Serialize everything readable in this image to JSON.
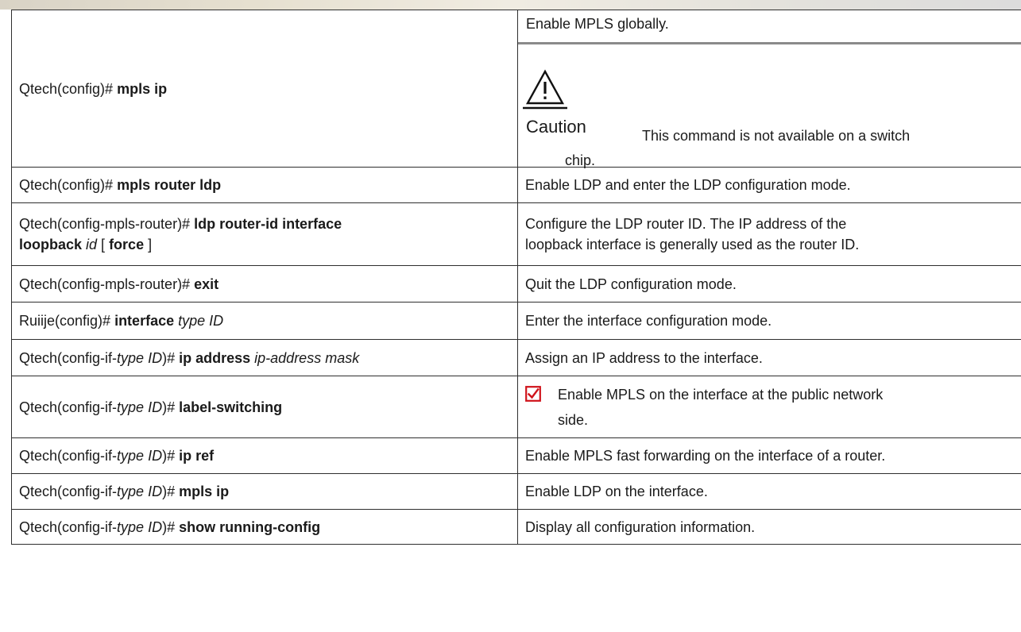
{
  "rows": [
    {
      "cmd": [
        {
          "t": "Qtech(config)# "
        },
        {
          "t": "mpls ip",
          "b": true
        }
      ],
      "desc": "Enable MPLS globally.",
      "caution": {
        "label": "Caution",
        "message": "This command is not available on a switch",
        "message_cont": "chip."
      }
    },
    {
      "cmd": [
        {
          "t": "Qtech(config)# "
        },
        {
          "t": "mpls router ldp",
          "b": true
        }
      ],
      "desc": "Enable LDP and enter the LDP configuration mode."
    },
    {
      "cmd": [
        {
          "t": "Qtech(config-mpls-router)# "
        },
        {
          "t": "ldp router-id interface",
          "b": true
        },
        {
          "br": true
        },
        {
          "t": "loopback",
          "b": true
        },
        {
          "t": " "
        },
        {
          "t": "id",
          "i": true
        },
        {
          "t": " [ "
        },
        {
          "t": "force",
          "b": true
        },
        {
          "t": " ]"
        }
      ],
      "desc": [
        "Configure the LDP router ID. The IP address of the",
        "loopback interface is generally used as the router ID."
      ]
    },
    {
      "cmd": [
        {
          "t": "Qtech(config-mpls-router)# "
        },
        {
          "t": "exit",
          "b": true
        }
      ],
      "desc": "Quit the LDP configuration mode."
    },
    {
      "cmd": [
        {
          "t": "Ruiije(config)# "
        },
        {
          "t": "interface",
          "b": true
        },
        {
          "t": " "
        },
        {
          "t": "type ID",
          "i": true
        }
      ],
      "desc": "Enter the interface configuration mode."
    },
    {
      "cmd": [
        {
          "t": "Qtech(config-if-"
        },
        {
          "t": "type ID",
          "i": true
        },
        {
          "t": ")# "
        },
        {
          "t": "ip address",
          "b": true
        },
        {
          "t": " "
        },
        {
          "t": "ip-address mask",
          "i": true
        }
      ],
      "desc": "Assign an IP address to the interface."
    },
    {
      "cmd": [
        {
          "t": "Qtech(config-if-"
        },
        {
          "t": "type ID",
          "i": true
        },
        {
          "t": ")# "
        },
        {
          "t": "label-switching",
          "b": true
        }
      ],
      "note": {
        "icon": "checkbox-checked-icon",
        "lines": [
          "Enable MPLS on the interface at the public network",
          "side."
        ]
      }
    },
    {
      "cmd": [
        {
          "t": "Qtech(config-if-"
        },
        {
          "t": "type ID",
          "i": true
        },
        {
          "t": ")# "
        },
        {
          "t": "ip ref",
          "b": true
        }
      ],
      "desc": "Enable MPLS fast forwarding on the interface of a router."
    },
    {
      "cmd": [
        {
          "t": "Qtech(config-if-"
        },
        {
          "t": "type ID",
          "i": true
        },
        {
          "t": ")# "
        },
        {
          "t": "mpls ip",
          "b": true
        }
      ],
      "desc": "Enable LDP on the interface."
    },
    {
      "cmd": [
        {
          "t": "Qtech(config-if-"
        },
        {
          "t": "type ID",
          "i": true
        },
        {
          "t": ")# "
        },
        {
          "t": "show running-config",
          "b": true
        }
      ],
      "desc": "Display all configuration information."
    }
  ],
  "colors": {
    "border": "#2e2e2e",
    "separator": "#8a8a8a",
    "check": "#d0131b",
    "text": "#1a1a1a"
  }
}
